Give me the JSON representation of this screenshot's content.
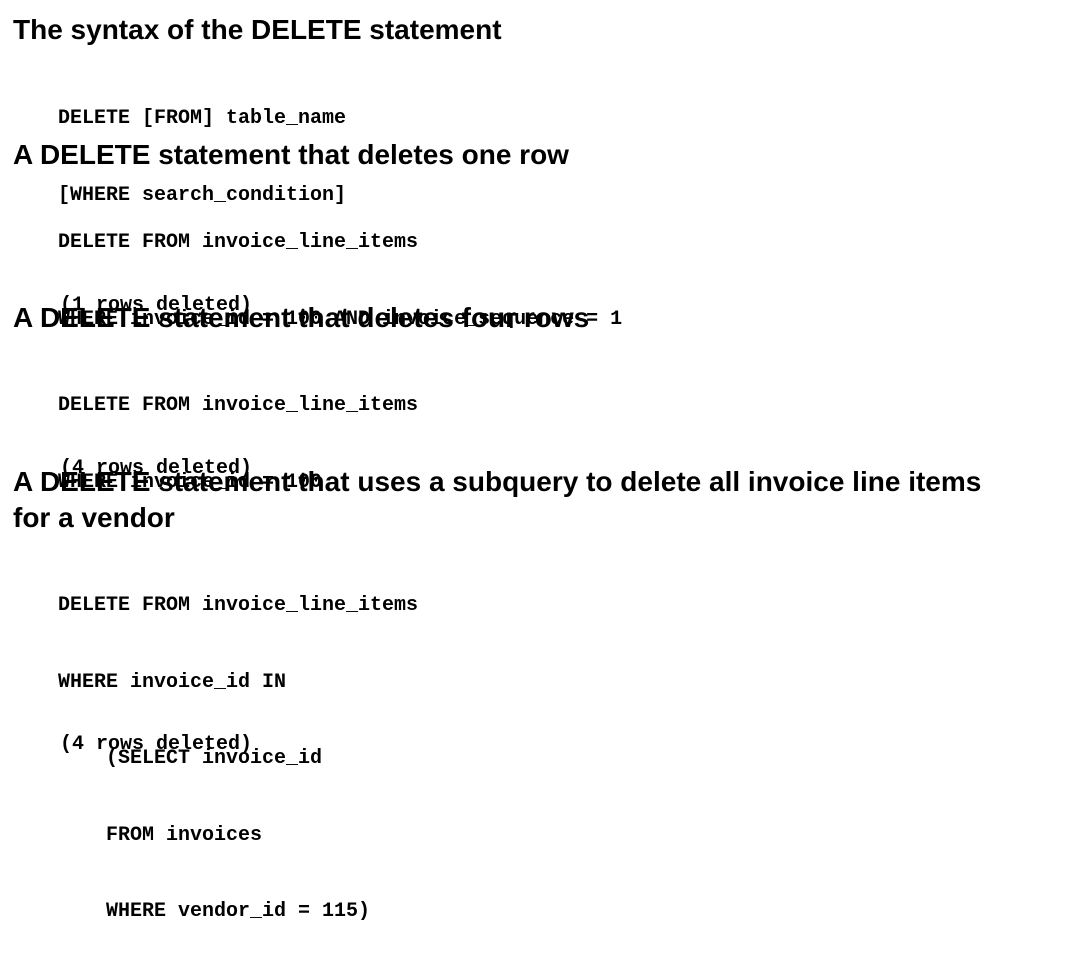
{
  "sections": [
    {
      "heading": "The syntax of the DELETE statement",
      "code": [
        "DELETE [FROM] table_name",
        "[WHERE search_condition]"
      ]
    },
    {
      "heading": "A DELETE statement that deletes one row",
      "code": [
        "DELETE FROM invoice_line_items",
        "WHERE invoice_id = 100 AND invoice_sequence = 1"
      ],
      "result": "(1 rows deleted)"
    },
    {
      "heading": "A DELETE statement that deletes four rows",
      "code": [
        "DELETE FROM invoice_line_items",
        "WHERE invoice_id = 100"
      ],
      "result": "(4 rows deleted)"
    },
    {
      "heading_lines": [
        "A DELETE statement that uses a subquery to delete all invoice line items",
        "for a vendor"
      ],
      "code": [
        "DELETE FROM invoice_line_items",
        "WHERE invoice_id IN",
        "    (SELECT invoice_id",
        "    FROM invoices",
        "    WHERE vendor_id = 115)"
      ],
      "result": "(4 rows deleted)"
    }
  ]
}
